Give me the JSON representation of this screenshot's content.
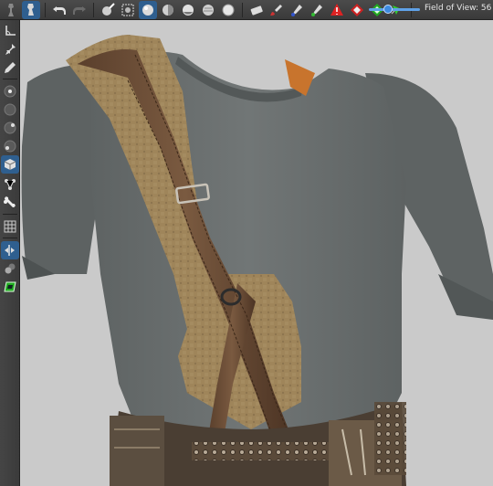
{
  "toolbar": {
    "fov_label": "Field of View: 56",
    "fov_value": 56,
    "icons": [
      "pose-figure-icon",
      "select-figure-icon",
      "undo-icon",
      "redo-icon",
      "render-icon",
      "spot-render-icon",
      "sphere-preview-icon",
      "smooth-shading-icon",
      "toon-shading-icon",
      "texture-shading-icon",
      "wireframe-icon",
      "eraser-icon",
      "brush-icon",
      "dropper-icon",
      "paint-icon",
      "warning-icon",
      "geometry-icon",
      "pointer-tool-icon"
    ]
  },
  "lefttoolbar": {
    "icons": [
      "angle-tool-icon",
      "pin-tool-icon",
      "pen-tool-icon",
      "rotate-node-icon",
      "twist-node-icon",
      "scale-node-icon",
      "translate-node-icon",
      "cube-node-icon",
      "joint-tool-icon",
      "bone-tool-icon",
      "grid-tool-icon",
      "symmetry-tool-icon",
      "spheres-tool-icon",
      "camera-tool-icon"
    ]
  },
  "colors": {
    "shirt": "#6b7070",
    "leather": "#6d5039",
    "canvas": "#a2875d",
    "accent": "#3d8ae0"
  }
}
